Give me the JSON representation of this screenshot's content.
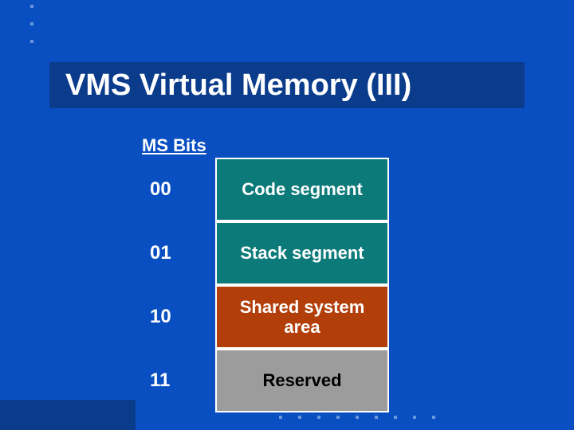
{
  "title": "VMS Virtual Memory (III)",
  "header_label": "MS Bits",
  "rows": [
    {
      "bits": "00",
      "label": "Code segment"
    },
    {
      "bits": "01",
      "label": "Stack segment"
    },
    {
      "bits": "10",
      "label": "Shared system area"
    },
    {
      "bits": "11",
      "label": "Reserved"
    }
  ]
}
